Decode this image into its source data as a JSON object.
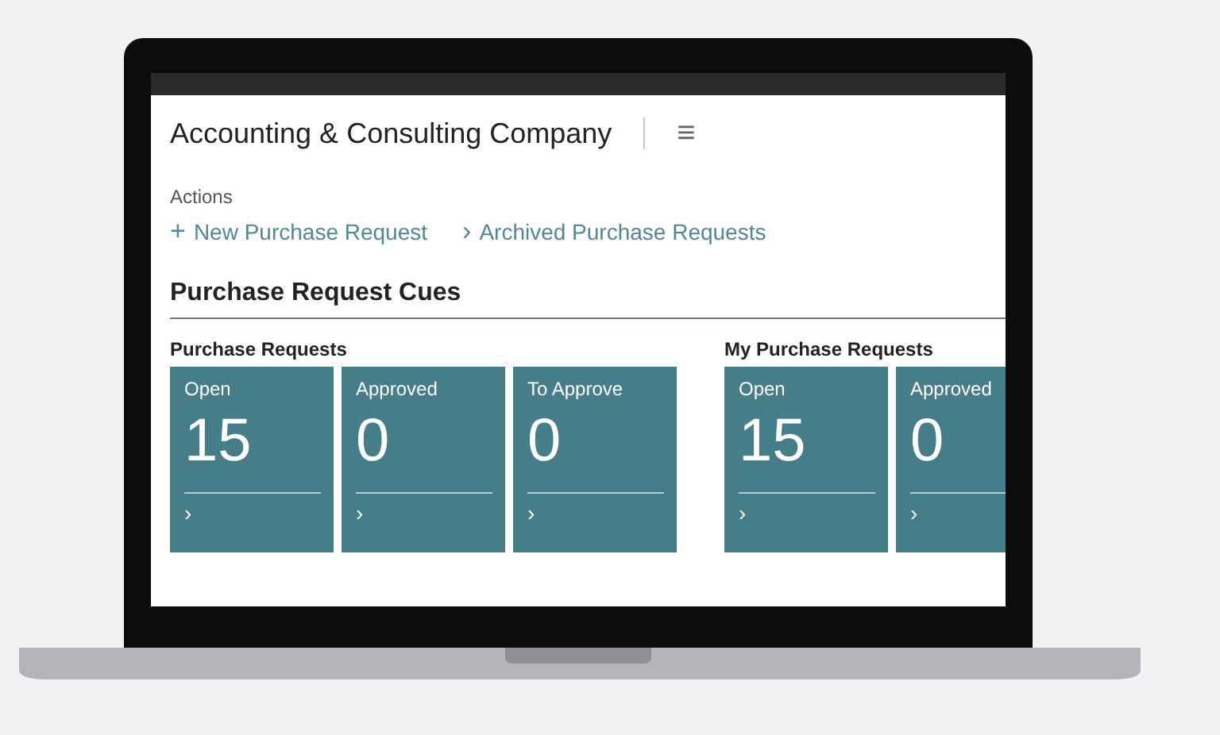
{
  "company": {
    "name": "Accounting & Consulting Company",
    "menu_icon": "≡"
  },
  "actions": {
    "caption": "Actions",
    "items": [
      {
        "label": "New Purchase Request",
        "icon": "+"
      },
      {
        "label": "Archived Purchase Requests",
        "icon": "›"
      }
    ]
  },
  "cues": {
    "title": "Purchase Request Cues",
    "groups": [
      {
        "title": "Purchase Requests",
        "tiles": [
          {
            "label": "Open",
            "value": "15",
            "arrow": "›"
          },
          {
            "label": "Approved",
            "value": "0",
            "arrow": "›"
          },
          {
            "label": "To Approve",
            "value": "0",
            "arrow": "›"
          }
        ]
      },
      {
        "title": "My Purchase Requests",
        "tiles": [
          {
            "label": "Open",
            "value": "15",
            "arrow": "›"
          },
          {
            "label": "Approved",
            "value": "0",
            "arrow": "›"
          }
        ]
      }
    ]
  }
}
